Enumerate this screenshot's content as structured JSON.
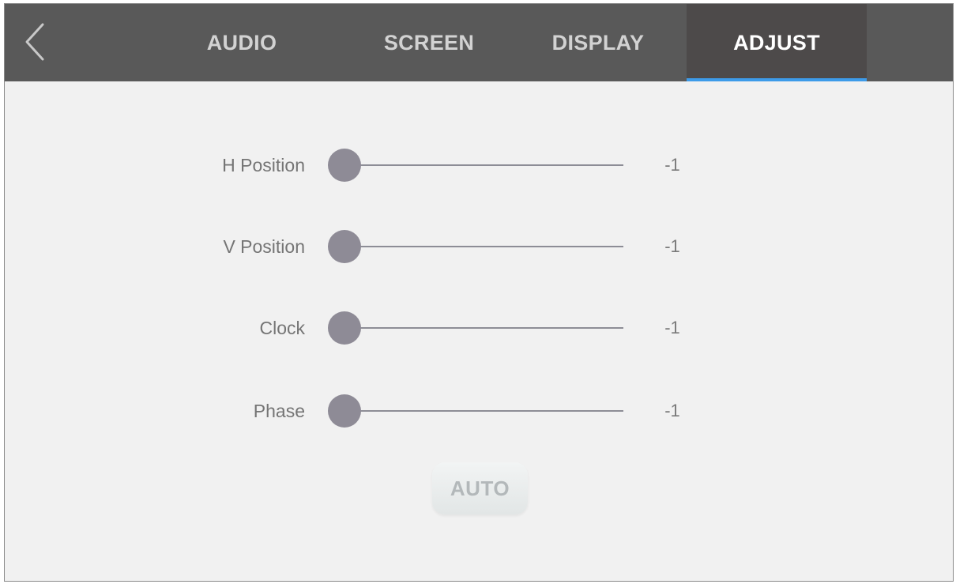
{
  "header": {
    "tabs": [
      {
        "label": "AUDIO",
        "active": false
      },
      {
        "label": "SCREEN",
        "active": false
      },
      {
        "label": "DISPLAY",
        "active": false
      },
      {
        "label": "ADJUST",
        "active": true
      }
    ],
    "back_icon": "chevron-left-icon"
  },
  "settings": [
    {
      "label": "H Position",
      "value": "-1",
      "level": 0
    },
    {
      "label": "V Position",
      "value": "-1",
      "level": 0
    },
    {
      "label": "Clock",
      "value": "-1",
      "level": 0
    },
    {
      "label": "Phase",
      "value": "-1",
      "level": 0
    }
  ],
  "auto_button": {
    "label": "AUTO"
  },
  "colors": {
    "header_bg": "#595959",
    "active_tab_bg": "#4d4a4a",
    "active_indicator": "#3d9be9",
    "content_bg": "#f1f1f1",
    "slider_thumb": "#8e8b96"
  }
}
